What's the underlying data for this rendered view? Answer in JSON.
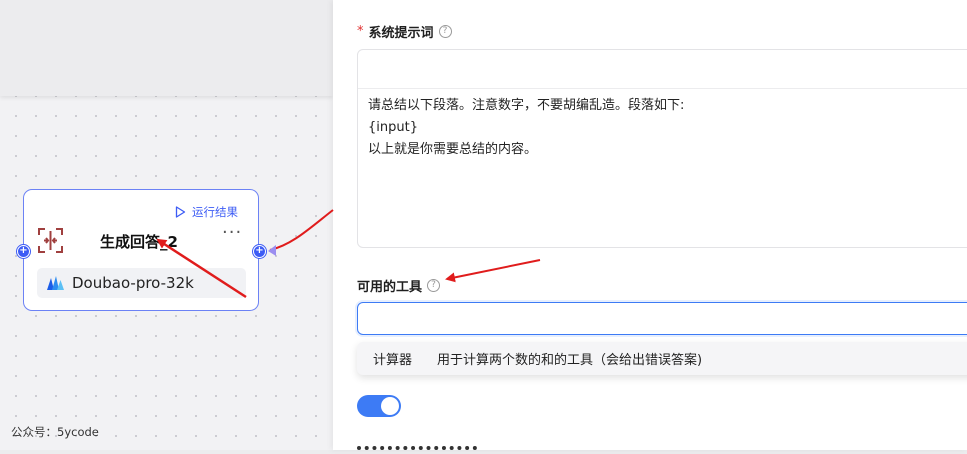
{
  "node": {
    "run_result_label": "运行结果",
    "title": "生成回答_2",
    "more_label": "···",
    "model_name": "Doubao-pro-32k",
    "port_symbol": "+"
  },
  "watermark": "公众号：5ycode",
  "panel": {
    "system_prompt": {
      "required_mark": "*",
      "label": "系统提示词",
      "help": "?",
      "lines": [
        "请总结以下段落。注意数字，不要胡编乱造。段落如下:",
        "{input}",
        "以上就是你需要总结的内容。"
      ]
    },
    "tools": {
      "label": "可用的工具",
      "help": "?",
      "input_value": "",
      "options": [
        {
          "name": "计算器",
          "description": "用于计算两个数的和的工具（会给出错误答案)"
        }
      ]
    },
    "toggle_on": true
  },
  "colors": {
    "accent": "#3d7bf5",
    "node_border": "#6c82f5",
    "port": "#3d5cf5",
    "annotation_arrow": "#e01c1c",
    "node_icon": "#a0403f"
  }
}
